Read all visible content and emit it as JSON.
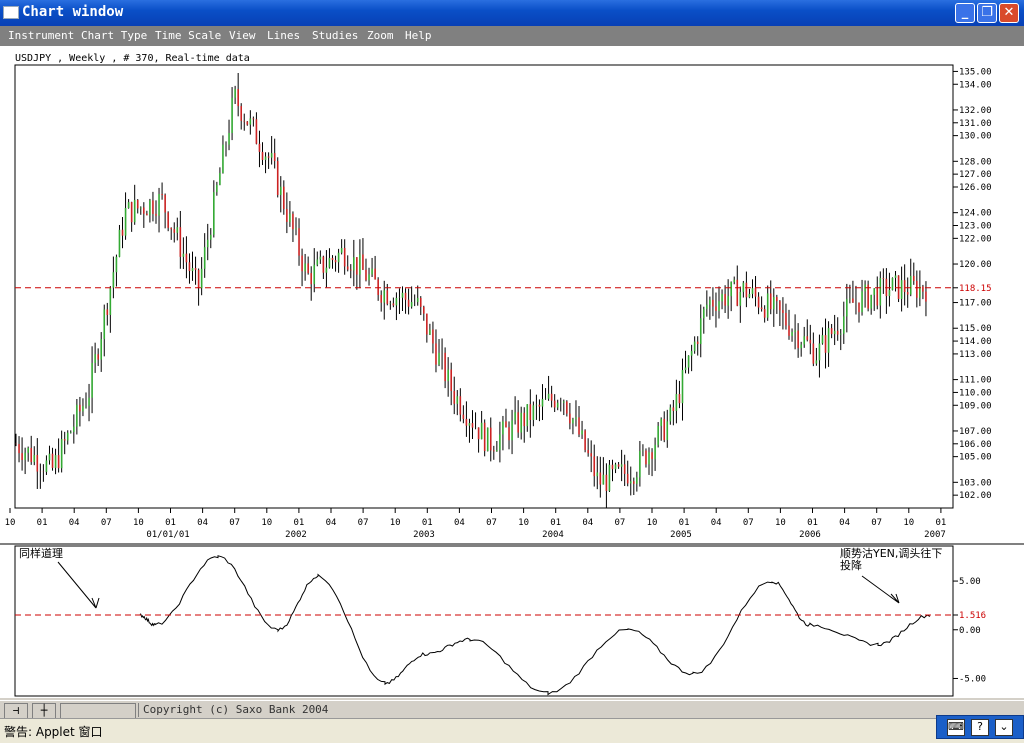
{
  "window": {
    "title": "Chart window"
  },
  "menu": [
    "Instrument",
    "Chart Type",
    "Time Scale",
    "View",
    "Lines",
    "Studies",
    "Zoom",
    "Help"
  ],
  "chart": {
    "header": "USDJPY , Weekly , # 370, Real-time data",
    "price_ticks": [
      "135.00",
      "134.00",
      "132.00",
      "131.00",
      "130.00",
      "128.00",
      "127.00",
      "126.00",
      "124.00",
      "123.00",
      "122.00",
      "120.00",
      "118.15",
      "117.00",
      "115.00",
      "114.00",
      "113.00",
      "111.00",
      "110.00",
      "109.00",
      "107.00",
      "106.00",
      "105.00",
      "103.00",
      "102.00"
    ],
    "current_price": "118.15",
    "month_ticks": [
      "10",
      "01",
      "04",
      "07",
      "10",
      "01",
      "04",
      "07",
      "10",
      "01",
      "04",
      "07",
      "10",
      "01",
      "04",
      "07",
      "10",
      "01",
      "04",
      "07",
      "10",
      "01",
      "04",
      "07",
      "10",
      "01",
      "04",
      "07",
      "10",
      "01"
    ],
    "year_labels": [
      "01/01/01",
      "2002",
      "2003",
      "2004",
      "2005",
      "2006",
      "2007"
    ],
    "indicator_ticks": [
      "5.00",
      "1.516",
      "0.00",
      "-5.00"
    ],
    "indicator_level": "1.516",
    "annotation_left": "同样道理",
    "annotation_right_line1": "顺势沽YEN,调头往下",
    "annotation_right_line2": "投降"
  },
  "chart_data": {
    "type": "line",
    "title": "USDJPY , Weekly , # 370, Real-time data",
    "series": [
      {
        "type": "ohlc-weekly",
        "x": [
          "2000-10",
          "2001-01",
          "2001-04",
          "2001-07",
          "2001-10",
          "2002-01",
          "2002-04",
          "2002-07",
          "2002-10",
          "2003-01",
          "2003-04",
          "2003-07",
          "2003-10",
          "2004-01",
          "2004-04",
          "2004-07",
          "2004-10",
          "2005-01",
          "2005-04",
          "2005-07",
          "2005-10",
          "2006-01",
          "2006-04",
          "2006-07",
          "2006-10",
          "2006-12"
        ],
        "values": [
          106,
          104,
          110,
          124,
          125,
          118,
          133,
          128,
          119,
          121,
          118,
          117,
          110,
          106,
          108,
          110,
          103,
          104,
          108,
          117,
          118,
          116,
          113,
          117,
          118.15,
          118.15
        ]
      },
      {
        "type": "indicator",
        "values": [
          1.5,
          0.5,
          7.5,
          0.0,
          5.5,
          -5.5,
          -2.5,
          -1.0,
          -6.5,
          0.0,
          -4.5,
          5.0,
          0.5,
          -1.5,
          1.5
        ]
      }
    ],
    "reference_lines": {
      "price": 118.15,
      "indicator": 1.516
    },
    "ylim_price": [
      101,
      135.5
    ],
    "ylim_indicator": [
      -6.8,
      8.6
    ],
    "grid": false
  },
  "statusbar": {
    "copyright": "Copyright (c) Saxo Bank 2004"
  },
  "warning": {
    "text": "警告: Applet 窗口"
  },
  "tray": [
    "⌨",
    "?",
    "⌄"
  ]
}
